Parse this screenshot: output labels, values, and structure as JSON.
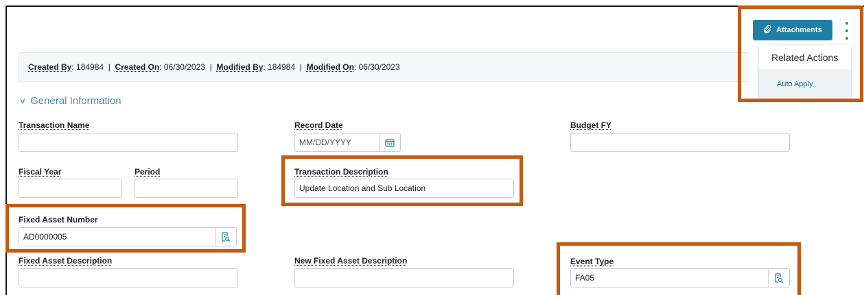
{
  "toolbar": {
    "attachments_label": "Attachments",
    "attachments_icon": "paperclip-icon",
    "more_icon": "kebab-menu-icon"
  },
  "related_actions": {
    "title": "Related Actions",
    "items": [
      "Auto Apply"
    ]
  },
  "audit": {
    "created_by_label": "Created By",
    "created_by": "184984",
    "created_on_label": "Created On",
    "created_on": "06/30/2023",
    "modified_by_label": "Modified By",
    "modified_by": "184984",
    "modified_on_label": "Modified On",
    "modified_on": "06/30/2023"
  },
  "section": {
    "title": "General Information"
  },
  "fields": {
    "transaction_name": {
      "label": "Transaction Name",
      "value": ""
    },
    "record_date": {
      "label": "Record Date",
      "placeholder": "MM/DD/YYYY"
    },
    "budget_fy": {
      "label": "Budget FY",
      "value": ""
    },
    "fiscal_year": {
      "label": "Fiscal Year",
      "value": ""
    },
    "period": {
      "label": "Period",
      "value": ""
    },
    "transaction_description": {
      "label": "Transaction Description",
      "value": "Update Location and Sub Location"
    },
    "fixed_asset_number": {
      "label": "Fixed Asset Number",
      "value": "AD0000005"
    },
    "fixed_asset_description": {
      "label": "Fixed Asset Description",
      "value": ""
    },
    "new_fixed_asset_description": {
      "label": "New Fixed Asset Description",
      "value": ""
    },
    "event_type": {
      "label": "Event Type",
      "value": "FA05"
    }
  },
  "colors": {
    "accent": "#1f7fa7",
    "highlight": "#c55a11",
    "section_title": "#4f86a6",
    "kebab": "#1d9a8a"
  }
}
